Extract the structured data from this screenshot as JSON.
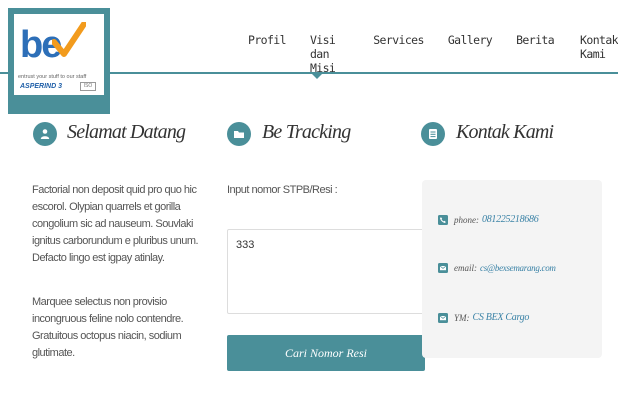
{
  "logo": {
    "brand": "be",
    "tagline": "entrust your stuff to our staff",
    "sub_brand": "ASPERIND 3",
    "badge": "ISO"
  },
  "nav": {
    "items": [
      {
        "label": "Profil"
      },
      {
        "label": "Visi dan Misi"
      },
      {
        "label": "Services"
      },
      {
        "label": "Gallery"
      },
      {
        "label": "Berita"
      },
      {
        "label": "Kontak Kami"
      }
    ]
  },
  "sections": {
    "welcome": {
      "icon": "user-icon",
      "title": "Selamat Datang",
      "para1": "Factorial non deposit quid pro quo hic escorol. Olypian quarrels et gorilla congolium sic ad nauseum. Souvlaki ignitus carborundum e pluribus unum. Defacto lingo est igpay atinlay.",
      "para2": "Marquee selectus non provisio incongruous feline nolo contendre. Gratuitous octopus niacin, sodium glutimate."
    },
    "tracking": {
      "icon": "folder-icon",
      "title": "Be Tracking",
      "input_label": "Input nomor STPB/Resi :",
      "input_value": "333",
      "button_label": "Cari Nomor Resi"
    },
    "contact": {
      "icon": "list-icon",
      "title": "Kontak Kami",
      "phone_key": "phone:",
      "phone_value": "081225218686",
      "email_key": "email:",
      "email_value": "cs@bexsemarang.com",
      "ym_key": "YM:",
      "ym_value": "CS BEX Cargo"
    }
  },
  "colors": {
    "accent": "#4a8f99",
    "link": "#3a82a6",
    "logo_blue": "#2d6fb8",
    "logo_orange": "#f29b1d"
  }
}
